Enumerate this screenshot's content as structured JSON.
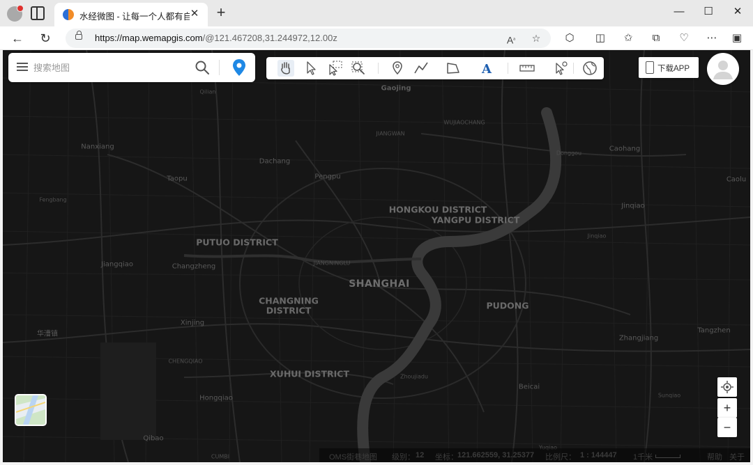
{
  "browser": {
    "tab_title": "水经微图 - 让每一个人都有自己的",
    "url_host": "https://map.wemapgis.com",
    "url_path": "/@121.467208,31.244972,12.00z",
    "colors": {
      "tab_strip": "#e9e9e9",
      "toolbar": "#ffffff"
    }
  },
  "search": {
    "placeholder": "搜索地图",
    "icons": [
      "menu-icon",
      "search-icon",
      "location-pin-icon"
    ]
  },
  "tools": {
    "items": [
      "hand-pan-icon",
      "pointer-select-icon",
      "box-select-icon",
      "zoom-area-icon",
      "place-marker-icon",
      "polyline-icon",
      "polygon-icon",
      "text-icon",
      "ruler-icon",
      "identify-icon",
      "globe-icon"
    ]
  },
  "download": {
    "label": "下载APP"
  },
  "map": {
    "theme": "dark",
    "colors": {
      "background": "#161616",
      "river": "#3a3a3a",
      "road": "#2b2b2b"
    },
    "labels": {
      "shanghai": "SHANGHAI",
      "hongkou": "HONGKOU DISTRICT",
      "yangpu": "YANGPU DISTRICT",
      "putuo": "PUTUO DISTRICT",
      "changning": "CHANGNING",
      "district": "DISTRICT",
      "xuhui": "XUHUI DISTRICT",
      "pudong": "PUDONG",
      "gaojing": "Gaojing",
      "qilian": "Qilian",
      "nanxiang": "Nanxiang",
      "dachang": "Dachang",
      "taopu": "Taopu",
      "pengpu": "Pengpu",
      "fengbang": "Fengbang",
      "jiangqiao": "Jiangqiao",
      "changzheng": "Changzheng",
      "xinjing": "Xinjing",
      "huacao": "华漕镇",
      "hongqiao": "Hongqiao",
      "qibao": "Qibao",
      "caohang": "Caohang",
      "caolu": "Caolu",
      "jinqiao": "Jinqiao",
      "jinqiao2": "Jinqiao",
      "dongou": "Donggou",
      "zhangjiang": "Zhangjiang",
      "tangzhen": "Tangzhen",
      "beicai": "Beicai",
      "sunqiao": "Sunqiao",
      "zhoujiadu": "Zhoujiadu",
      "jiangwan": "JIANGWAN",
      "wusong": "WUJIAOCHANG",
      "jiangningl": "JIANGNINGLU",
      "chengqiao": "CHENGQIAO",
      "yuqiao": "Yuqiao",
      "cumbi": "CUMBI"
    }
  },
  "status": {
    "source": "OMS街巷地图",
    "level_label": "级别：",
    "level": "12",
    "coord_label": "坐标：",
    "coord": "121.662559, 31.25377",
    "scale_label": "比例尺：",
    "scale": "1 : 144447",
    "distance": "1千米",
    "help": "帮助",
    "about": "关于"
  }
}
